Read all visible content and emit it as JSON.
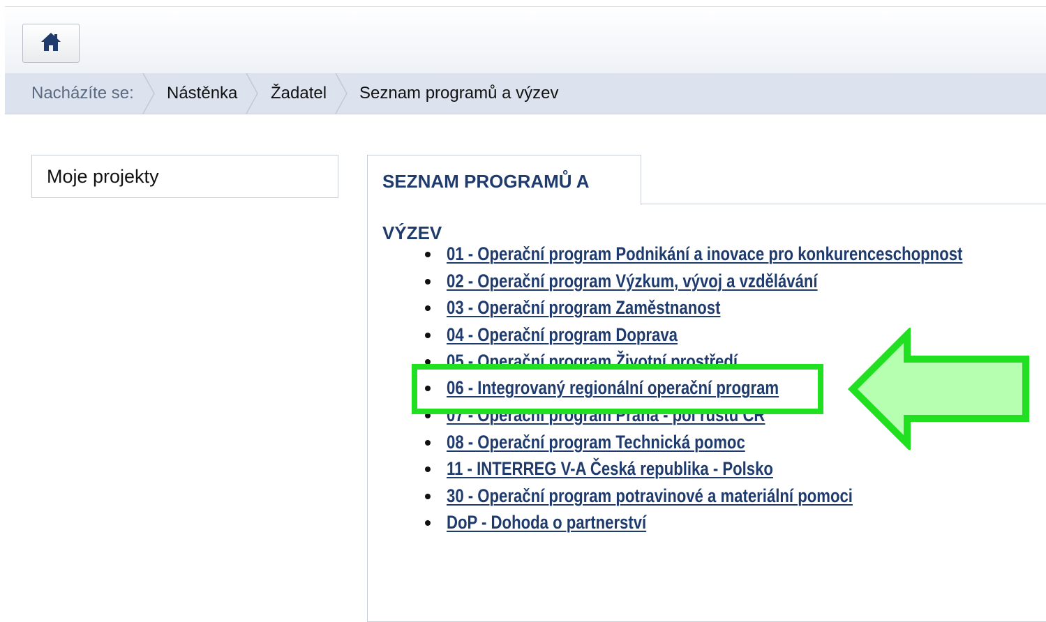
{
  "header": {
    "home_icon": "home-icon"
  },
  "breadcrumb": {
    "label": "Nacházíte se:",
    "items": [
      "Nástěnka",
      "Žadatel",
      "Seznam programů a výzev"
    ]
  },
  "sidebar": {
    "box_label": "Moje projekty"
  },
  "main": {
    "tab_label": "SEZNAM PROGRAMŮ A VÝZEV",
    "programs": [
      "01 - Operační program Podnikání a inovace pro konkurenceschopnost",
      "02 - Operační program Výzkum, vývoj a vzdělávání",
      "03 - Operační program Zaměstnanost",
      "04 - Operační program Doprava",
      "05 - Operační program Životní prostředí",
      "06 - Integrovaný regionální operační program",
      "07 - Operační program Praha - pól růstu ČR",
      "08 - Operační program Technická pomoc",
      "11 - INTERREG V-A Česká republika - Polsko",
      "30 - Operační program potravinové a materiální pomoci",
      "DoP - Dohoda o partnerství"
    ]
  },
  "annotation": {
    "highlight_color": "#21e021",
    "arrow_fill": "#b6ffb0"
  }
}
